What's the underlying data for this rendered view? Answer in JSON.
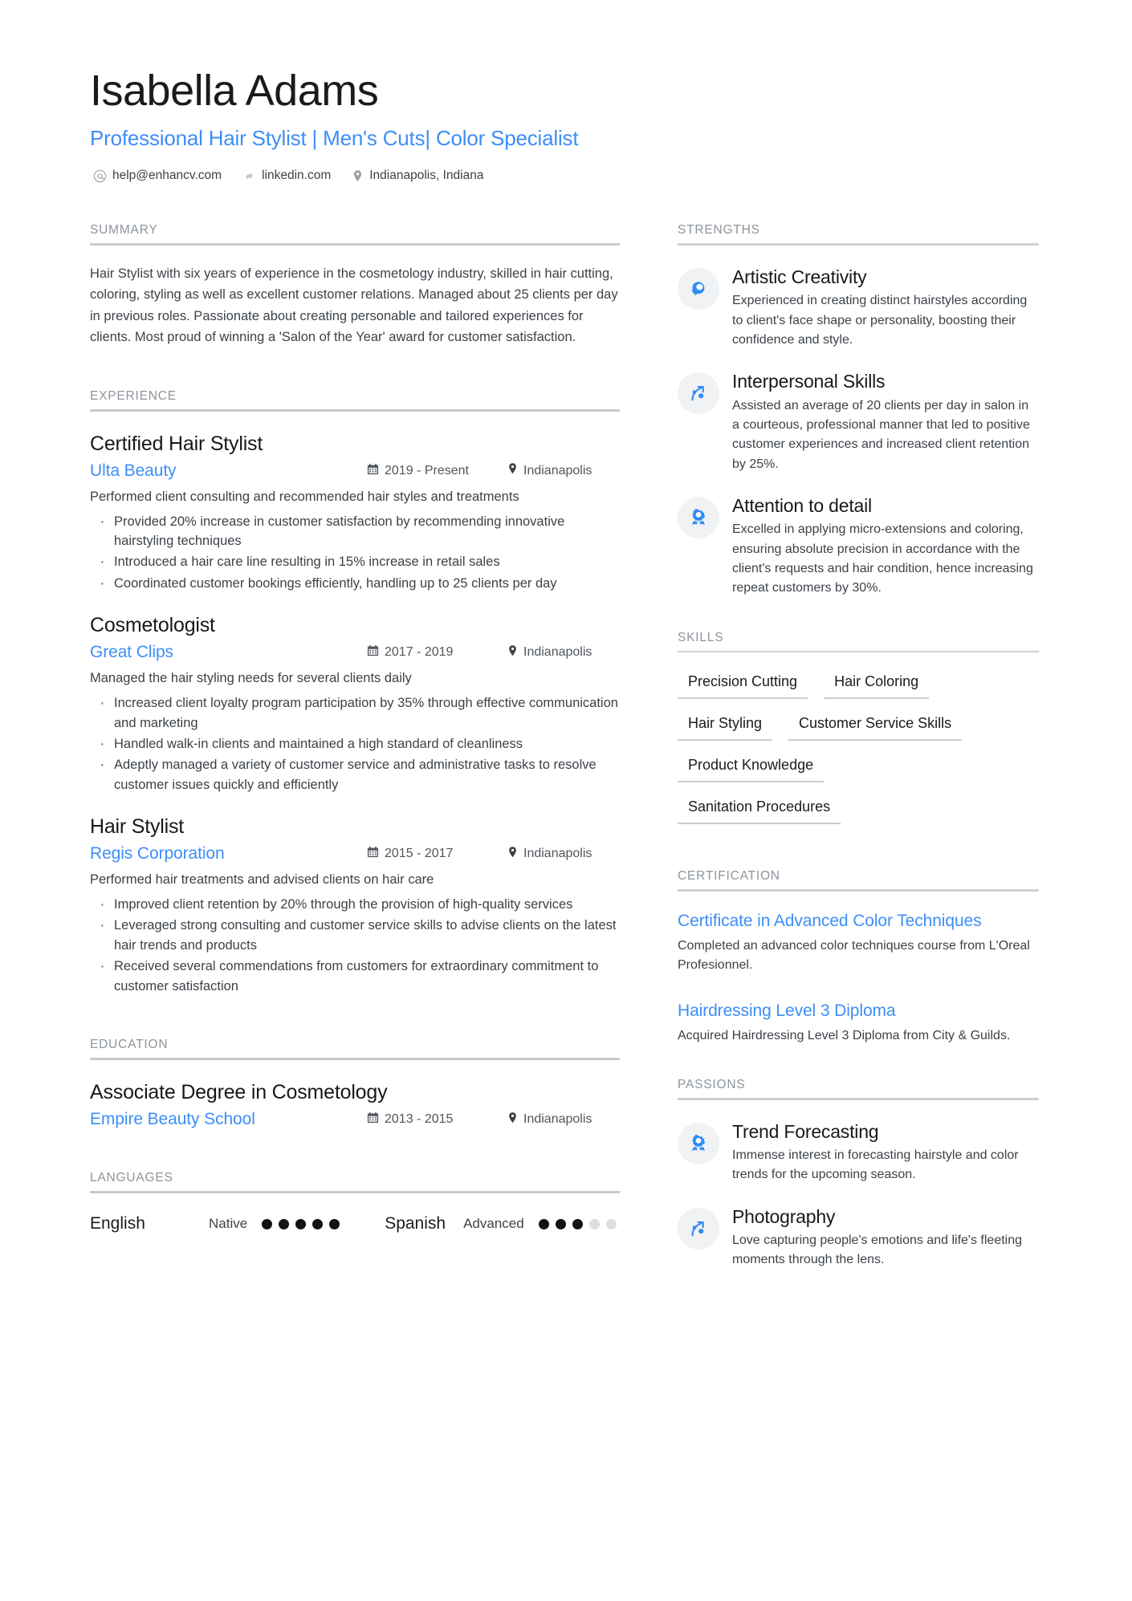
{
  "accent_color": "#3d8ef7",
  "header": {
    "name": "Isabella Adams",
    "headline": "Professional Hair Stylist | Men's Cuts| Color Specialist",
    "contacts": [
      {
        "icon": "email-icon",
        "text": "help@enhancv.com"
      },
      {
        "icon": "link-icon",
        "text": "linkedin.com"
      },
      {
        "icon": "location-pin-icon",
        "text": "Indianapolis, Indiana"
      }
    ]
  },
  "left": {
    "summary": {
      "heading": "SUMMARY",
      "text": "Hair Stylist with six years of experience in the cosmetology industry, skilled in hair cutting, coloring, styling as well as excellent customer relations. Managed about 25 clients per day in previous roles. Passionate about creating personable and tailored experiences for clients. Most proud of winning a 'Salon of the Year' award for customer satisfaction."
    },
    "experience": {
      "heading": "EXPERIENCE",
      "entries": [
        {
          "title": "Certified Hair Stylist",
          "org": "Ulta Beauty",
          "date": "2019 - Present",
          "location": "Indianapolis",
          "subtitle": "Performed client consulting and recommended hair styles and treatments",
          "bullets": [
            "Provided 20% increase in customer satisfaction by recommending innovative hairstyling techniques",
            "Introduced a hair care line resulting in 15% increase in retail sales",
            "Coordinated customer bookings efficiently, handling up to 25 clients per day"
          ]
        },
        {
          "title": "Cosmetologist",
          "org": "Great Clips",
          "date": "2017 - 2019",
          "location": "Indianapolis",
          "subtitle": "Managed the hair styling needs for several clients daily",
          "bullets": [
            "Increased client loyalty program participation by 35% through effective communication and marketing",
            "Handled walk-in clients and maintained a high standard of cleanliness",
            "Adeptly managed a variety of customer service and administrative tasks to resolve customer issues quickly and efficiently"
          ]
        },
        {
          "title": "Hair Stylist",
          "org": "Regis Corporation",
          "date": "2015 - 2017",
          "location": "Indianapolis",
          "subtitle": "Performed hair treatments and advised clients on hair care",
          "bullets": [
            "Improved client retention by 20% through the provision of high-quality services",
            "Leveraged strong consulting and customer service skills to advise clients on the latest hair trends and products",
            "Received several commendations from customers for extraordinary commitment to customer satisfaction"
          ]
        }
      ]
    },
    "education": {
      "heading": "EDUCATION",
      "entries": [
        {
          "title": "Associate Degree in Cosmetology",
          "org": "Empire Beauty School",
          "date": "2013 - 2015",
          "location": "Indianapolis"
        }
      ]
    },
    "languages": {
      "heading": "LANGUAGES",
      "items": [
        {
          "name": "English",
          "level": "Native",
          "filled": 5,
          "total": 5
        },
        {
          "name": "Spanish",
          "level": "Advanced",
          "filled": 3,
          "total": 5
        }
      ]
    }
  },
  "right": {
    "strengths": {
      "heading": "STRENGTHS",
      "items": [
        {
          "icon": "head-idea-icon",
          "title": "Artistic Creativity",
          "desc": "Experienced in creating distinct hairstyles according to client's face shape or personality, boosting their confidence and style."
        },
        {
          "icon": "growth-arrow-icon",
          "title": "Interpersonal Skills",
          "desc": "Assisted an average of 20 clients per day in salon in a courteous, professional manner that led to positive customer experiences and increased client retention by 25%."
        },
        {
          "icon": "award-ribbon-icon",
          "title": "Attention to detail",
          "desc": "Excelled in applying micro-extensions and coloring, ensuring absolute precision in accordance with the client's requests and hair condition, hence increasing repeat customers by 30%."
        }
      ]
    },
    "skills": {
      "heading": "SKILLS",
      "rows": [
        [
          "Precision Cutting",
          "Hair Coloring"
        ],
        [
          "Hair Styling",
          "Customer Service Skills"
        ],
        [
          "Product Knowledge"
        ],
        [
          "Sanitation Procedures"
        ]
      ]
    },
    "certification": {
      "heading": "CERTIFICATION",
      "items": [
        {
          "title": "Certificate in Advanced Color Techniques",
          "desc": "Completed an advanced color techniques course from L'Oreal Profesionnel."
        },
        {
          "title": "Hairdressing Level 3 Diploma",
          "desc": "Acquired Hairdressing Level 3 Diploma from City & Guilds."
        }
      ]
    },
    "passions": {
      "heading": "PASSIONS",
      "items": [
        {
          "icon": "award-ribbon-icon",
          "title": "Trend Forecasting",
          "desc": "Immense interest in forecasting hairstyle and color trends for the upcoming season."
        },
        {
          "icon": "growth-arrow-icon",
          "title": "Photography",
          "desc": "Love capturing people's emotions and life's fleeting moments through the lens."
        }
      ]
    }
  }
}
